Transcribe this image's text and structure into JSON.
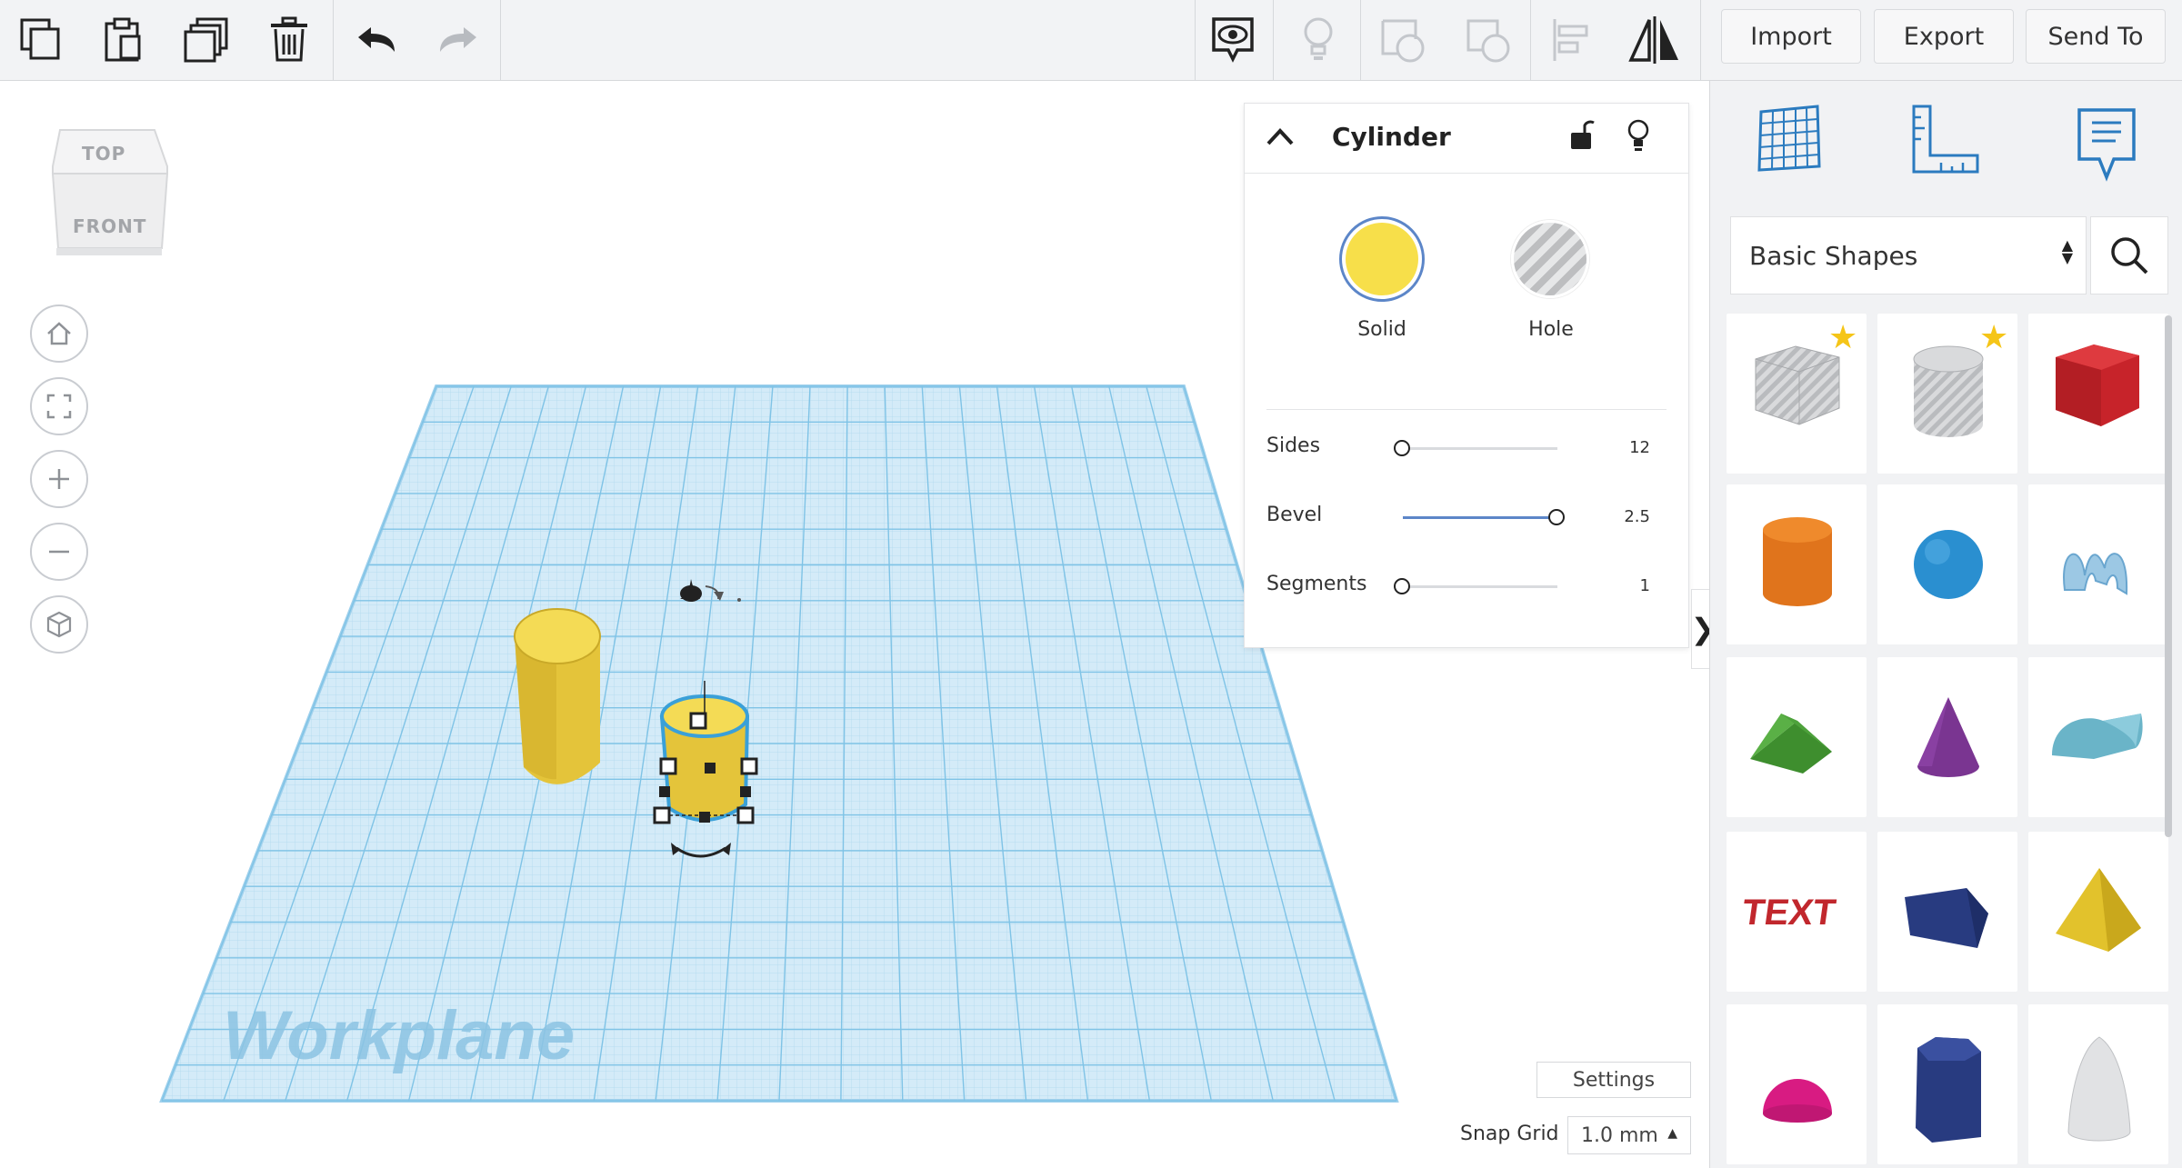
{
  "toolbar": {
    "left_tools": [
      {
        "name": "copy",
        "icon": "copy-icon"
      },
      {
        "name": "paste",
        "icon": "paste-icon"
      },
      {
        "name": "duplicate",
        "icon": "duplicate-icon"
      },
      {
        "name": "delete",
        "icon": "trash-icon"
      },
      {
        "name": "undo",
        "icon": "undo-icon"
      },
      {
        "name": "redo",
        "icon": "redo-icon"
      }
    ],
    "right_tools": [
      {
        "name": "show-all",
        "icon": "eye-speech-icon"
      },
      {
        "name": "hint",
        "icon": "lightbulb-icon"
      },
      {
        "name": "group",
        "icon": "group-icon"
      },
      {
        "name": "ungroup",
        "icon": "ungroup-icon"
      },
      {
        "name": "align",
        "icon": "align-icon"
      },
      {
        "name": "mirror",
        "icon": "mirror-icon"
      }
    ],
    "import_label": "Import",
    "export_label": "Export",
    "send_to_label": "Send To"
  },
  "view_cube": {
    "top": "TOP",
    "front": "FRONT"
  },
  "view_controls": [
    "home-icon",
    "fit-icon",
    "zoom-in-icon",
    "zoom-out-icon",
    "perspective-icon"
  ],
  "workplane": {
    "label": "Workplane",
    "grid_color": "#bfe0f2",
    "line_color": "#7fc3e6"
  },
  "inspector": {
    "title": "Cylinder",
    "solid_label": "Solid",
    "hole_label": "Hole",
    "solid_color": "#f7df4a",
    "sliders": [
      {
        "label": "Sides",
        "value": "12",
        "fraction": 0.0
      },
      {
        "label": "Bevel",
        "value": "2.5",
        "fraction": 1.0
      },
      {
        "label": "Segments",
        "value": "1",
        "fraction": 0.0
      }
    ]
  },
  "panel_tabs": [
    "workplane-grid-icon",
    "ruler-icon",
    "notes-icon"
  ],
  "library": {
    "selected": "Basic Shapes",
    "shapes": [
      {
        "name": "box-hole",
        "starred": true
      },
      {
        "name": "cylinder-hole",
        "starred": true
      },
      {
        "name": "box",
        "starred": false
      },
      {
        "name": "cylinder",
        "starred": false
      },
      {
        "name": "sphere",
        "starred": false
      },
      {
        "name": "scribble",
        "starred": false
      },
      {
        "name": "roof",
        "starred": false
      },
      {
        "name": "cone",
        "starred": false
      },
      {
        "name": "round-roof",
        "starred": false
      },
      {
        "name": "text",
        "starred": false
      },
      {
        "name": "wedge",
        "starred": false
      },
      {
        "name": "pyramid",
        "starred": false
      },
      {
        "name": "half-sphere",
        "starred": false
      },
      {
        "name": "polygon",
        "starred": false
      },
      {
        "name": "paraboloid",
        "starred": false
      }
    ]
  },
  "settings_label": "Settings",
  "snap_grid": {
    "label": "Snap Grid",
    "value": "1.0 mm"
  },
  "colors": {
    "accent": "#2b7bbf",
    "yellow": "#f3d54a",
    "toolbar_bg": "#f2f3f5"
  }
}
